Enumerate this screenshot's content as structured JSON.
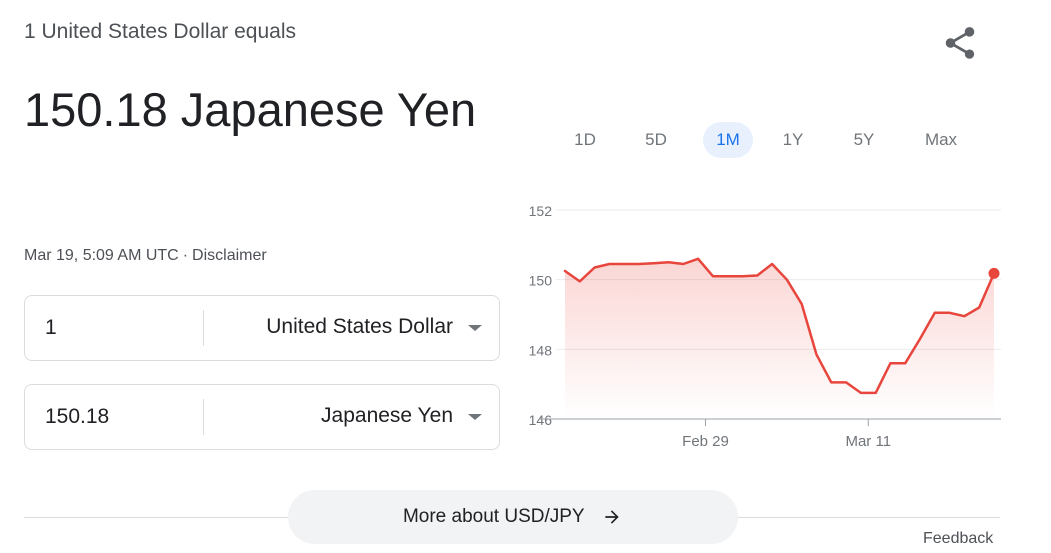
{
  "header": {
    "subtitle": "1 United States Dollar equals",
    "result": "150.18 Japanese Yen",
    "timestamp": "Mar 19, 5:09 AM UTC",
    "separator": "·",
    "disclaimer": "Disclaimer",
    "share_icon": "share-icon"
  },
  "converter": {
    "from": {
      "amount": "1",
      "currency": "United States Dollar"
    },
    "to": {
      "amount": "150.18",
      "currency": "Japanese Yen"
    }
  },
  "ranges": [
    {
      "label": "1D",
      "active": false
    },
    {
      "label": "5D",
      "active": false
    },
    {
      "label": "1M",
      "active": true
    },
    {
      "label": "1Y",
      "active": false
    },
    {
      "label": "5Y",
      "active": false
    },
    {
      "label": "Max",
      "active": false
    }
  ],
  "chart_data": {
    "type": "area",
    "title": "",
    "xlabel": "",
    "ylabel": "",
    "ylim": [
      146,
      152
    ],
    "yticks": [
      152,
      150,
      148,
      146
    ],
    "xtick_labels": [
      "Feb 29",
      "Mar 11"
    ],
    "line_color": "#e8453c",
    "grid": true,
    "series": [
      {
        "values": [
          150.25,
          149.95,
          150.35,
          150.45,
          150.45,
          150.45,
          150.47,
          150.5,
          150.45,
          150.6,
          150.1,
          150.1,
          150.1,
          150.12,
          150.45,
          150.0,
          149.3,
          147.85,
          147.05,
          147.05,
          146.75,
          146.75,
          147.6,
          147.6,
          148.3,
          149.05,
          149.05,
          148.95,
          149.2,
          150.18
        ]
      }
    ]
  },
  "footer": {
    "more_label": "More about USD/JPY",
    "arrow_icon": "arrow-right-icon",
    "feedback": "Feedback"
  }
}
